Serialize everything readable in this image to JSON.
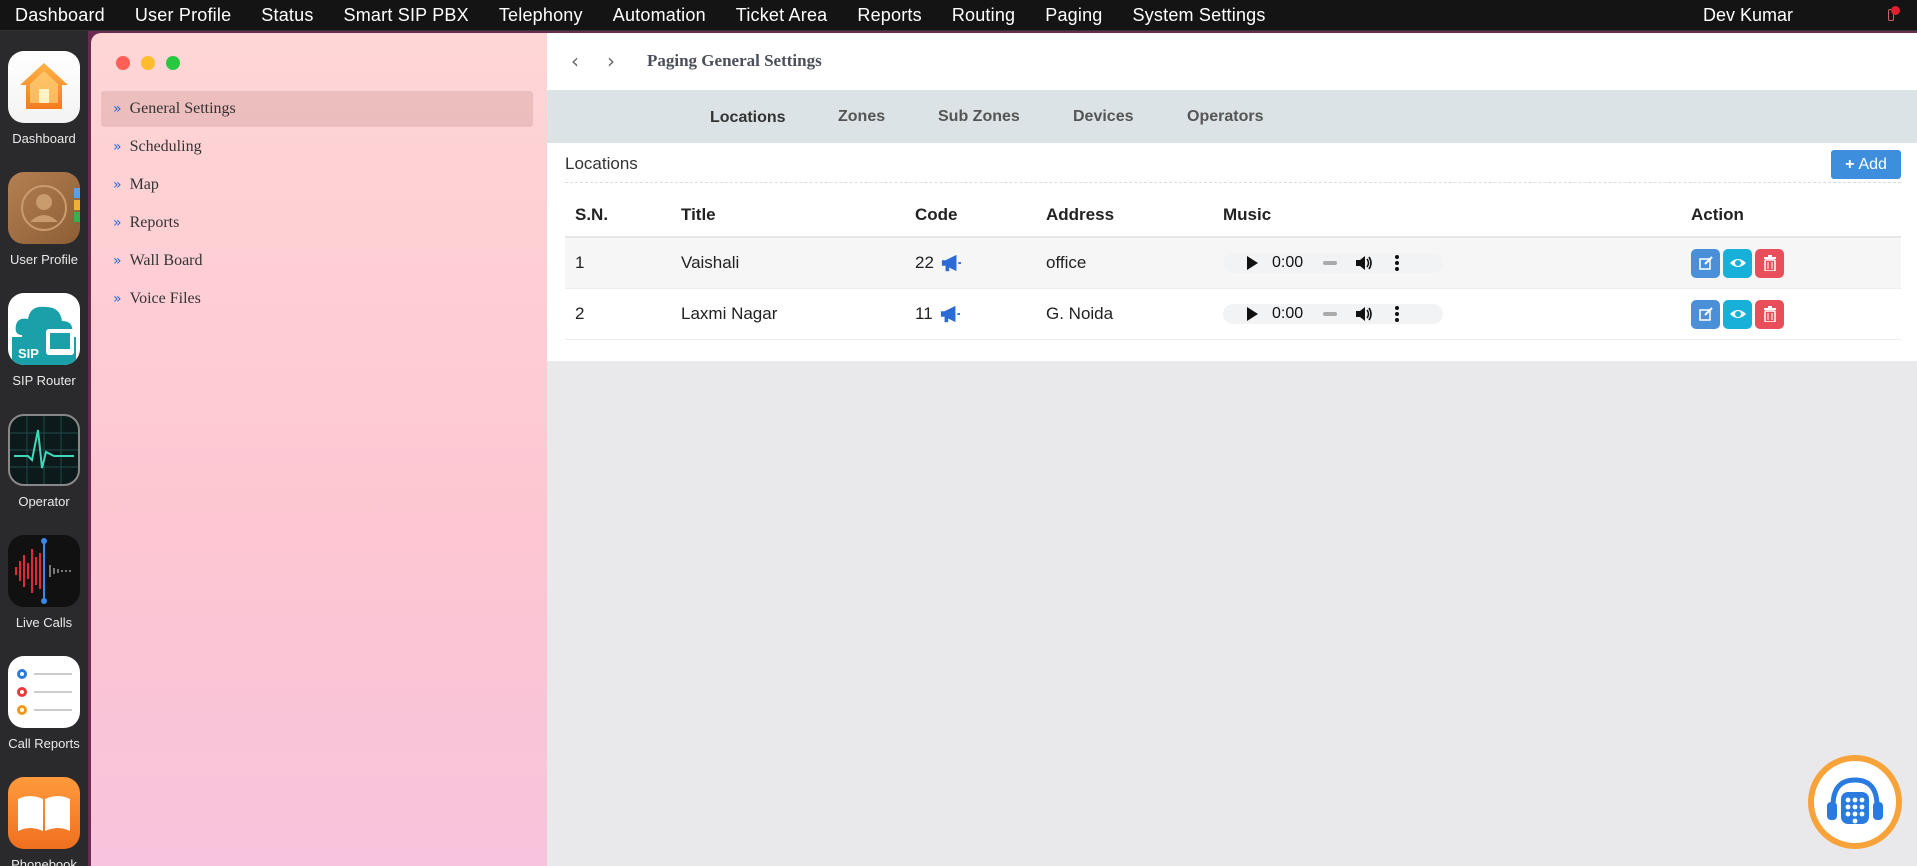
{
  "menubar": {
    "items": [
      "Dashboard",
      "User Profile",
      "Status",
      "Smart SIP PBX",
      "Telephony",
      "Automation",
      "Ticket Area",
      "Reports",
      "Routing",
      "Paging",
      "System Settings"
    ],
    "user": "Dev Kumar"
  },
  "dock": {
    "items": [
      {
        "label": "Dashboard",
        "icon": "home-icon"
      },
      {
        "label": "User Profile",
        "icon": "contacts-icon"
      },
      {
        "label": "SIP Router",
        "icon": "cloud-sip-icon",
        "badge": "SIP"
      },
      {
        "label": "Operator",
        "icon": "activity-monitor-icon"
      },
      {
        "label": "Live Calls",
        "icon": "voice-wave-icon"
      },
      {
        "label": "Call Reports",
        "icon": "reminders-list-icon"
      },
      {
        "label": "Phonebook",
        "icon": "book-icon"
      }
    ]
  },
  "sidebar": {
    "items": [
      {
        "label": "General Settings",
        "active": true
      },
      {
        "label": "Scheduling",
        "active": false
      },
      {
        "label": "Map",
        "active": false
      },
      {
        "label": "Reports",
        "active": false
      },
      {
        "label": "Wall Board",
        "active": false
      },
      {
        "label": "Voice Files",
        "active": false
      }
    ]
  },
  "header": {
    "title": "Paging General Settings"
  },
  "tabs": [
    {
      "label": "Locations",
      "active": true
    },
    {
      "label": "Zones",
      "active": false
    },
    {
      "label": "Sub Zones",
      "active": false
    },
    {
      "label": "Devices",
      "active": false
    },
    {
      "label": "Operators",
      "active": false
    }
  ],
  "section": {
    "title": "Locations",
    "add_label": "Add"
  },
  "table": {
    "columns": [
      "S.N.",
      "Title",
      "Code",
      "Address",
      "Music",
      "Action"
    ],
    "rows": [
      {
        "sn": "1",
        "title": "Vaishali",
        "code": "22",
        "address": "office",
        "music_time": "0:00"
      },
      {
        "sn": "2",
        "title": "Laxmi Nagar",
        "code": "11",
        "address": "G. Noida",
        "music_time": "0:00"
      }
    ]
  },
  "colors": {
    "accent_blue": "#3d8fde",
    "view_cyan": "#17b0d9",
    "delete_red": "#e84f5a",
    "support_orange": "#f7a33a"
  }
}
